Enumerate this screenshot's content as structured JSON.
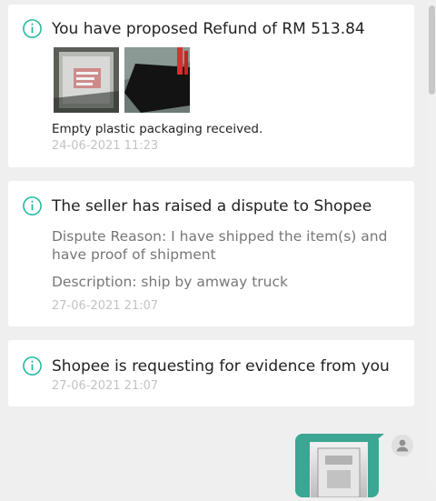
{
  "cards": [
    {
      "title": "You have proposed Refund of RM 513.84",
      "note": "Empty plastic packaging received.",
      "time": "24-06-2021 11:23",
      "images": [
        "evidence-photo-1",
        "evidence-photo-2"
      ]
    },
    {
      "title": "The seller has raised a dispute to Shopee",
      "reason": "Dispute Reason: I have shipped the item(s) and have proof of shipment",
      "description": "Description: ship by amway truck",
      "time": "27-06-2021 21:07"
    },
    {
      "title": "Shopee is requesting for evidence from you",
      "time": "27-06-2021 21:07"
    }
  ],
  "icons": {
    "info": "info-circle-icon",
    "avatar": "user-avatar-icon"
  },
  "colors": {
    "accent": "#1fb99f",
    "bubble": "#3aa693",
    "background": "#efefef",
    "card": "#ffffff",
    "timestamp": "#c3c3c3"
  }
}
